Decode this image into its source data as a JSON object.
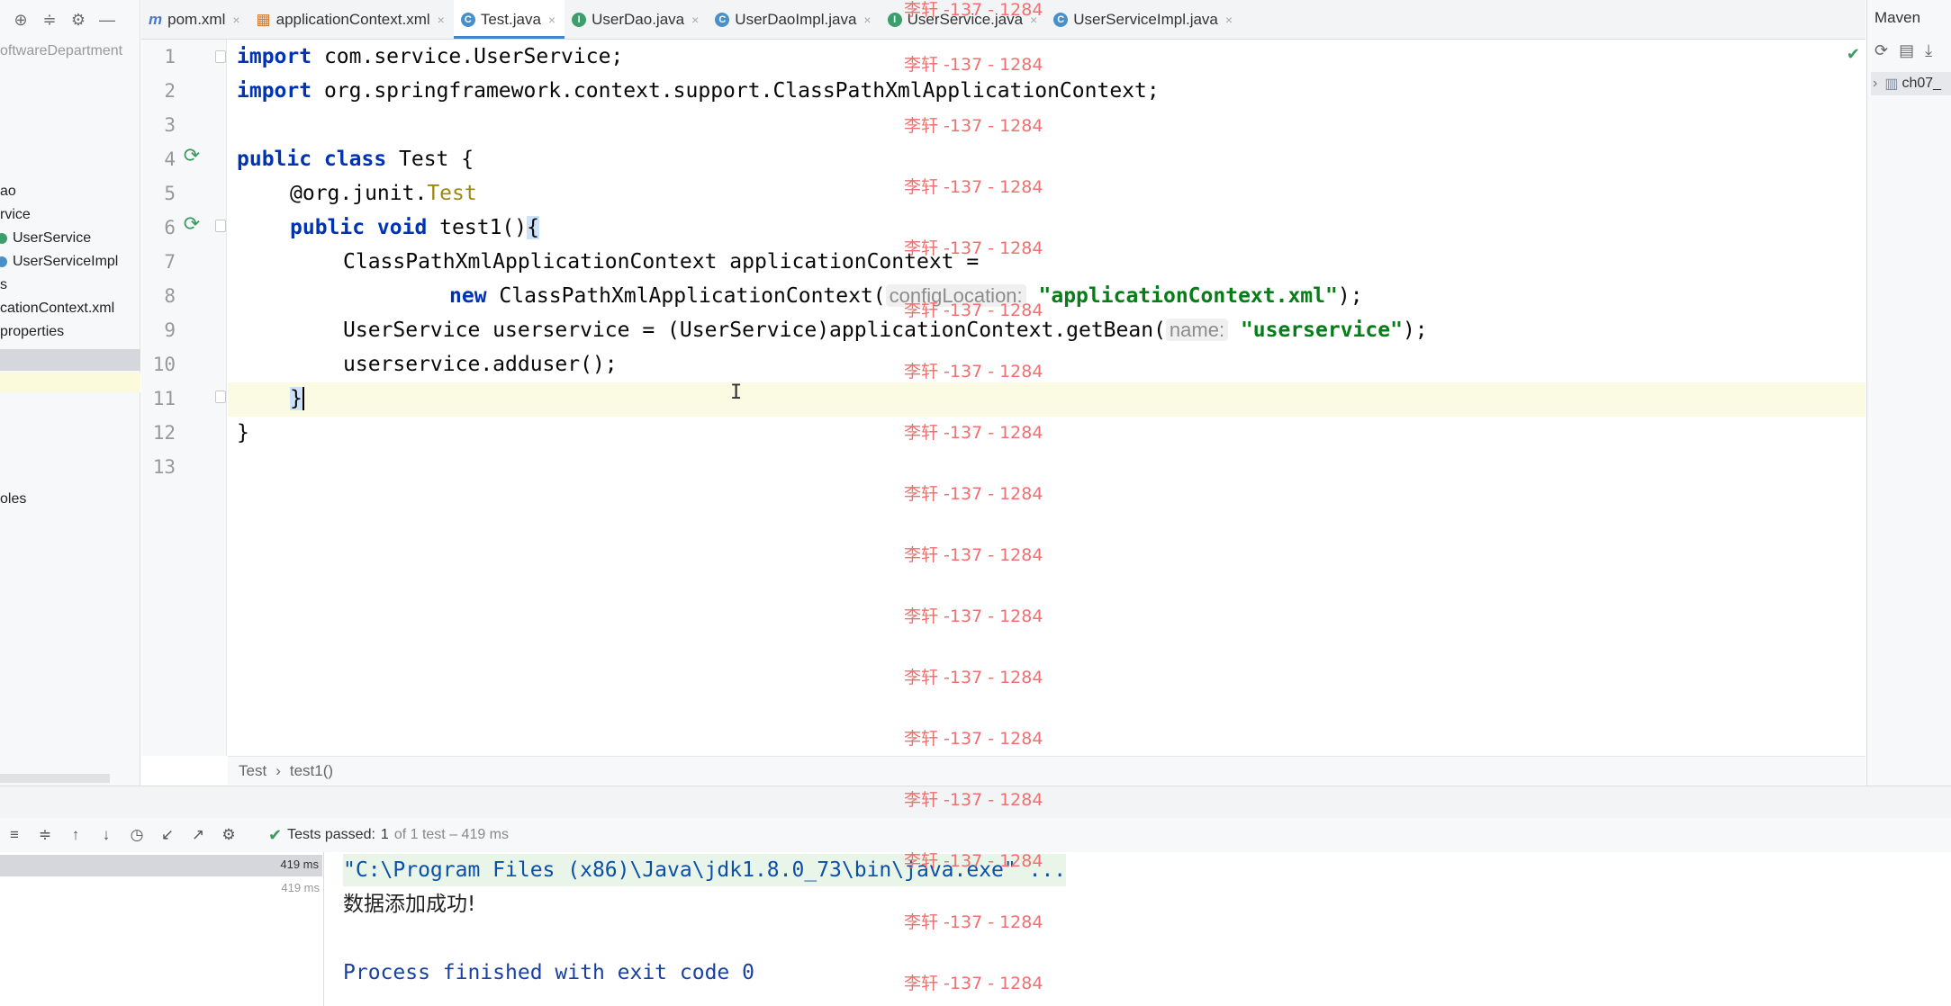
{
  "tabs": [
    {
      "label": "pom.xml",
      "icon": "maven-file-icon",
      "active": false
    },
    {
      "label": "applicationContext.xml",
      "icon": "xml-file-icon",
      "active": false
    },
    {
      "label": "Test.java",
      "icon": "java-class-icon",
      "active": true
    },
    {
      "label": "UserDao.java",
      "icon": "java-interface-icon",
      "active": false
    },
    {
      "label": "UserDaoImpl.java",
      "icon": "java-class-icon",
      "active": false
    },
    {
      "label": "UserService.java",
      "icon": "java-interface-icon",
      "active": false
    },
    {
      "label": "UserServiceImpl.java",
      "icon": "java-class-icon",
      "active": false
    }
  ],
  "project_tree": [
    "oftwareDepartment",
    "ao",
    "rvice",
    "UserService",
    "UserServiceImpl",
    "s",
    "cationContext.xml",
    "properties",
    "oles"
  ],
  "code_lines": [
    "1",
    "2",
    "3",
    "4",
    "5",
    "6",
    "7",
    "8",
    "9",
    "10",
    "11",
    "12",
    "13"
  ],
  "code": {
    "l1_kw": "import",
    "l1_rest": " com.service.UserService;",
    "l2_kw": "import",
    "l2_rest": " org.springframework.context.support.ClassPathXmlApplicationContext;",
    "l4_kw": "public class",
    "l4_rest": " Test {",
    "l5_at": "@org.junit.",
    "l5_ann": "Test",
    "l6_kw": "public void",
    "l6_rest": " test1()",
    "l6_brace": "{",
    "l7": "ClassPathXmlApplicationContext applicationContext =",
    "l8_kw": "new",
    "l8_rest": " ClassPathXmlApplicationContext(",
    "l8_hint": "configLocation:",
    "l8_str": "\"applicationContext.xml\"",
    "l8_end": ");",
    "l9_rest": "UserService userservice = (UserService)applicationContext.getBean(",
    "l9_hint": "name:",
    "l9_str": "\"userservice\"",
    "l9_end": ");",
    "l10": "userservice.adduser();",
    "l11": "}",
    "l12": "}"
  },
  "breadcrumb": {
    "class": "Test",
    "method": "test1()"
  },
  "maven": {
    "title": "Maven",
    "item": "ch07_"
  },
  "run": {
    "status_label": "Tests passed:",
    "status_count": "1",
    "status_detail": "of 1 test – 419 ms",
    "tree_time_1": "419 ms",
    "tree_time_2": "419 ms",
    "console_cmd": "\"C:\\Program Files (x86)\\Java\\jdk1.8.0_73\\bin\\java.exe\" ...",
    "console_out": "数据添加成功!",
    "console_exit": "Process finished with exit code 0"
  },
  "watermark": "李轩 -137 - 1284",
  "colors": {
    "keyword": "#0033b3",
    "string": "#067d17",
    "annotation": "#9e880d",
    "accent": "#4083c9",
    "watermark": "#f07070"
  }
}
